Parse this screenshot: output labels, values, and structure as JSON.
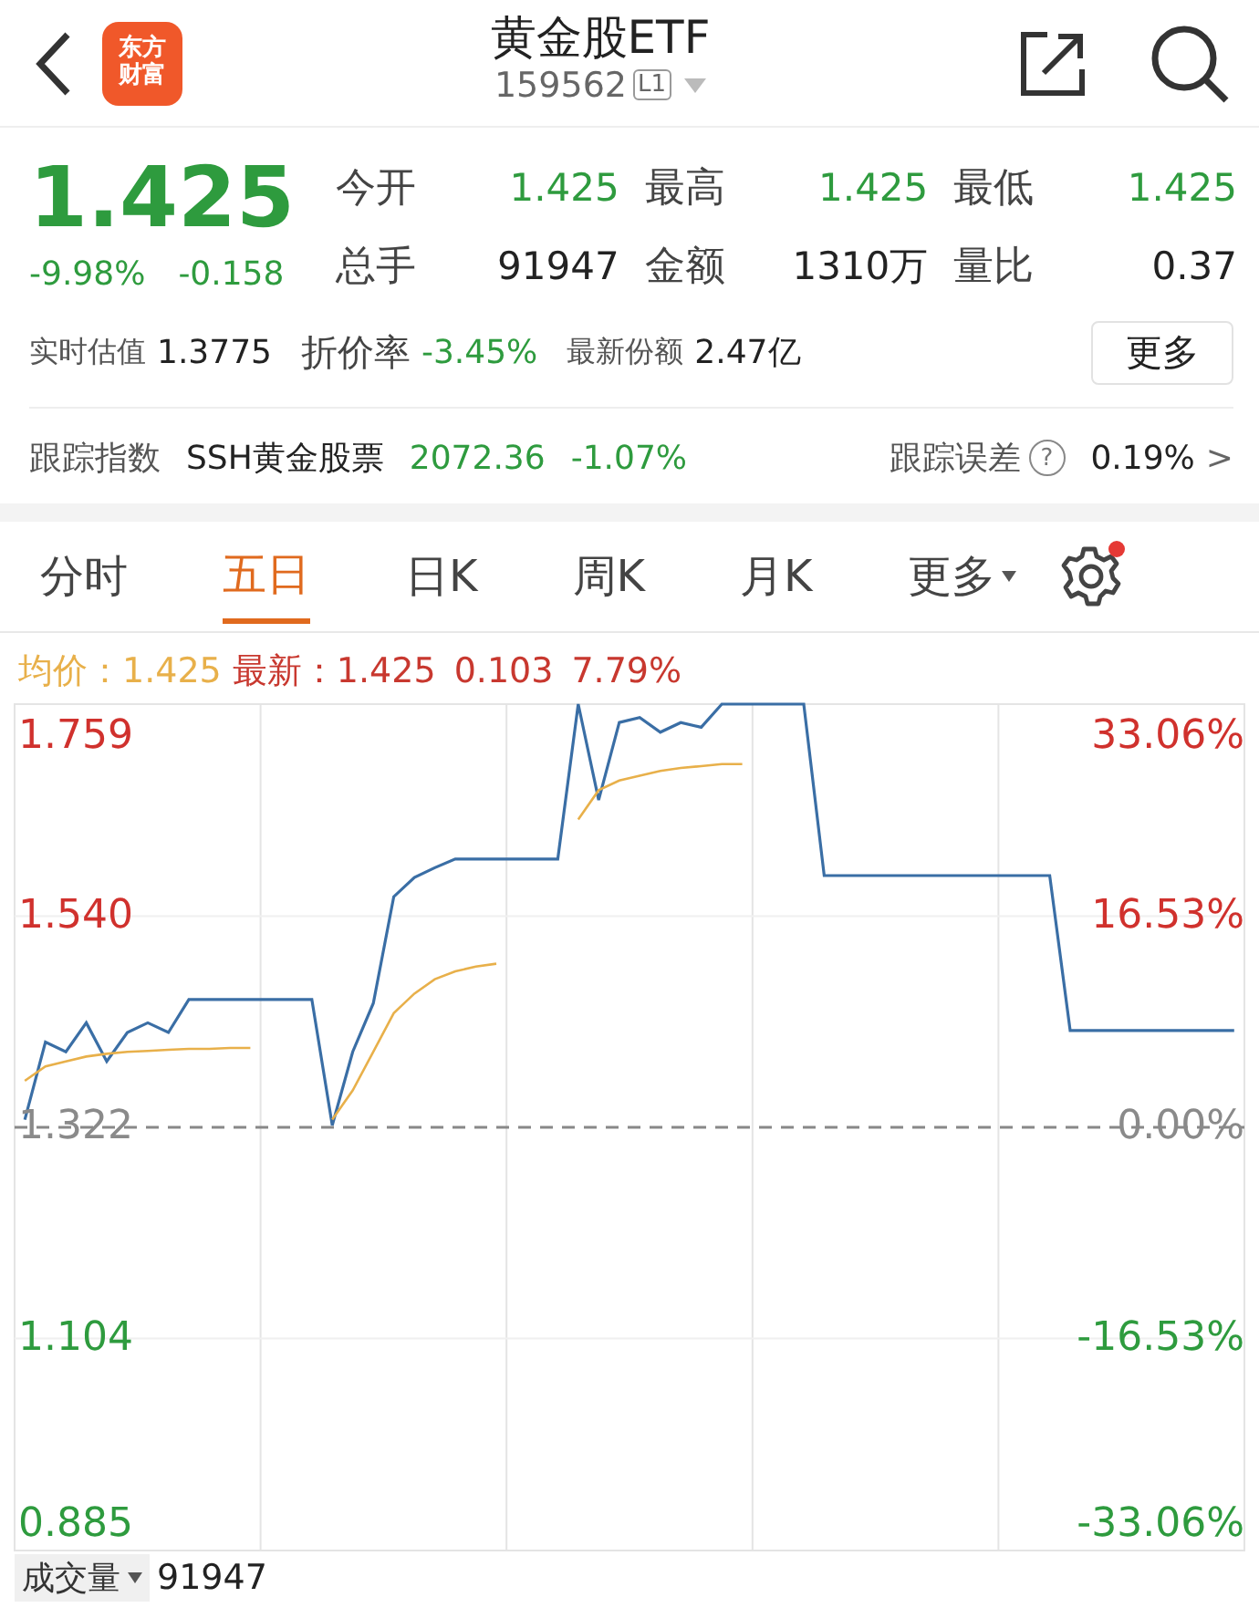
{
  "header": {
    "logo": [
      "东方",
      "财富"
    ],
    "title": "黄金股ETF",
    "code": "159562",
    "level_badge": "L1"
  },
  "quote": {
    "price": "1.425",
    "change_pct": "-9.98%",
    "change": "-0.158",
    "color": "#2e9b3e"
  },
  "stats": [
    {
      "label": "今开",
      "value": "1.425",
      "color": "#2e9b3e"
    },
    {
      "label": "最高",
      "value": "1.425",
      "color": "#2e9b3e"
    },
    {
      "label": "最低",
      "value": "1.425",
      "color": "#2e9b3e"
    },
    {
      "label": "总手",
      "value": "91947",
      "color": "#222222"
    },
    {
      "label": "金额",
      "value": "1310万",
      "color": "#222222"
    },
    {
      "label": "量比",
      "value": "0.37",
      "color": "#222222"
    }
  ],
  "info": [
    {
      "label": "实时估值",
      "value": "1.3775",
      "color": "#222222",
      "kind": "small"
    },
    {
      "label": "折价率",
      "value": "-3.45%",
      "color": "#2e9b3e",
      "kind": "large"
    },
    {
      "label": "最新份额",
      "value": "2.47亿",
      "color": "#222222",
      "kind": "small"
    }
  ],
  "more_button": "更多",
  "tracking": {
    "label": "跟踪指数",
    "index_name": "SSH黄金股票",
    "index_value": "2072.36",
    "index_change": "-1.07%",
    "color": "#2e9b3e",
    "error_label": "跟踪误差",
    "help_glyph": "?",
    "error_value": "0.19%",
    "chevron": ">"
  },
  "tabs": [
    {
      "label": "分时",
      "selected": false,
      "kind": "tab"
    },
    {
      "label": "五日",
      "selected": true,
      "kind": "tab"
    },
    {
      "label": "日K",
      "selected": false,
      "kind": "tab"
    },
    {
      "label": "周K",
      "selected": false,
      "kind": "tab"
    },
    {
      "label": "月K",
      "selected": false,
      "kind": "tab"
    },
    {
      "label": "更多",
      "selected": false,
      "kind": "menu"
    }
  ],
  "settings": {
    "notification_dot": true
  },
  "legend": {
    "avg_value": "1.425",
    "latest_value": "1.425",
    "latest_change": "0.103",
    "latest_pct": "7.79%"
  },
  "chart": {
    "chart_data": {
      "type": "line",
      "ylim": [
        0.885,
        1.759
      ],
      "ref_lines": [
        {
          "value": 1.322,
          "axis": "y"
        }
      ],
      "yticks": [
        {
          "value": 1.759,
          "label": "1.759"
        },
        {
          "value": 1.54,
          "label": "1.540"
        },
        {
          "value": 1.322,
          "label": "1.322"
        },
        {
          "value": 1.104,
          "label": "1.104"
        },
        {
          "value": 0.885,
          "label": "0.885"
        }
      ],
      "series": [
        {
          "name": "最新：",
          "color": "#3a6ea5",
          "values": [
            1.33,
            1.41,
            1.4,
            1.43,
            1.39,
            1.42,
            1.43,
            1.42,
            1.454,
            1.454,
            1.454,
            1.454,
            1.454,
            1.454,
            1.454,
            1.324,
            1.4,
            1.45,
            1.56,
            1.58,
            1.59,
            1.599,
            1.599,
            1.599,
            1.599,
            1.599,
            1.599,
            1.759,
            1.66,
            1.74,
            1.745,
            1.73,
            1.74,
            1.735,
            1.759,
            1.759,
            1.759,
            1.759,
            1.759,
            1.582,
            1.582,
            1.582,
            1.582,
            1.582,
            1.582,
            1.582,
            1.582,
            1.582,
            1.582,
            1.582,
            1.582,
            1.422,
            1.422,
            1.422,
            1.422,
            1.422,
            1.422,
            1.422,
            1.422,
            1.422
          ]
        },
        {
          "name": "均价：",
          "color": "#e8b04a",
          "values": [
            1.37,
            1.385,
            1.39,
            1.395,
            1.398,
            1.4,
            1.401,
            1.402,
            1.403,
            1.403,
            1.404,
            1.404,
            null,
            null,
            null,
            1.33,
            1.36,
            1.4,
            1.44,
            1.46,
            1.475,
            1.483,
            1.488,
            1.491,
            null,
            null,
            null,
            1.64,
            1.67,
            1.68,
            1.685,
            1.69,
            1.693,
            1.695,
            1.697,
            1.697,
            null,
            null,
            null,
            null,
            null,
            null,
            null,
            null,
            null,
            null,
            null,
            null,
            null,
            null,
            null,
            null,
            null,
            null,
            null,
            null,
            null,
            null,
            null,
            null
          ]
        }
      ]
    },
    "percent_labels": [
      "33.06%",
      "16.53%",
      "0.00%",
      "-16.53%",
      "-33.06%"
    ]
  },
  "volume": {
    "label": "成交量",
    "value": "91947"
  }
}
